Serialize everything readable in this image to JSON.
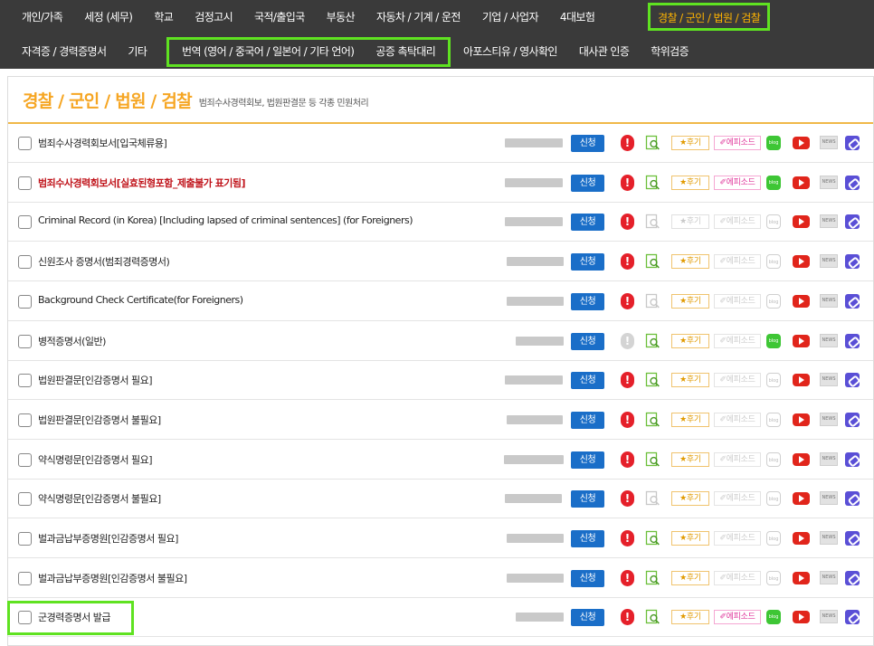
{
  "nav": {
    "row1": [
      "개인/가족",
      "세정 (세무)",
      "학교",
      "검정고시",
      "국적/출입국",
      "부동산",
      "자동차 / 기계 / 운전",
      "기업 / 사업자",
      "4대보험"
    ],
    "row1_active": "경찰 / 군인 / 법원 / 검찰",
    "row2_first": [
      "자격증 / 경력증명서",
      "기타"
    ],
    "row2_group": [
      "번역 (영어 / 중국어 / 일본어 / 기타 언어)",
      "공증 촉탁대리"
    ],
    "row2_rest": [
      "아포스티유 / 영사확인",
      "대사관 인증",
      "학위검증"
    ]
  },
  "page": {
    "title": "경찰 / 군인 / 법원 / 검찰",
    "subtitle": "범죄수사경력회보, 법원판결문 등 각종 민원처리"
  },
  "buttons": {
    "apply": "신청",
    "review": "★후기",
    "episode": "✐에피소드",
    "blog": "blog",
    "news": "NEWS"
  },
  "rows": [
    {
      "label": "범죄수사경력회보서[입국체류용]"
    },
    {
      "label": "범죄수사경력회보서[실효된형포함_제출불가 표기됨]"
    },
    {
      "label": "Criminal Record (in Korea) [Including lapsed of criminal sentences] (for Foreigners)"
    },
    {
      "label": "신원조사 증명서(범죄경력증명서)"
    },
    {
      "label": "Background Check Certificate(for Foreigners)"
    },
    {
      "label": "병적증명서(일반)"
    },
    {
      "label": "법원판결문[인감증명서 필요]"
    },
    {
      "label": "법원판결문[인감증명서 불필요]"
    },
    {
      "label": "약식명령문[인감증명서 필요]"
    },
    {
      "label": "약식명령문[인감증명서 불필요]"
    },
    {
      "label": "벌과금납부증명원[인감증명서 필요]"
    },
    {
      "label": "벌과금납부증명원[인감증명서 불필요]"
    },
    {
      "label": "군경력증명서 발급"
    }
  ],
  "colors": {
    "nav_bg": "#3a3a3a",
    "active": "#ffb400",
    "highlight": "#5fe221",
    "apply_button": "#1a6ec8",
    "emphasis_text": "#c0141b"
  }
}
